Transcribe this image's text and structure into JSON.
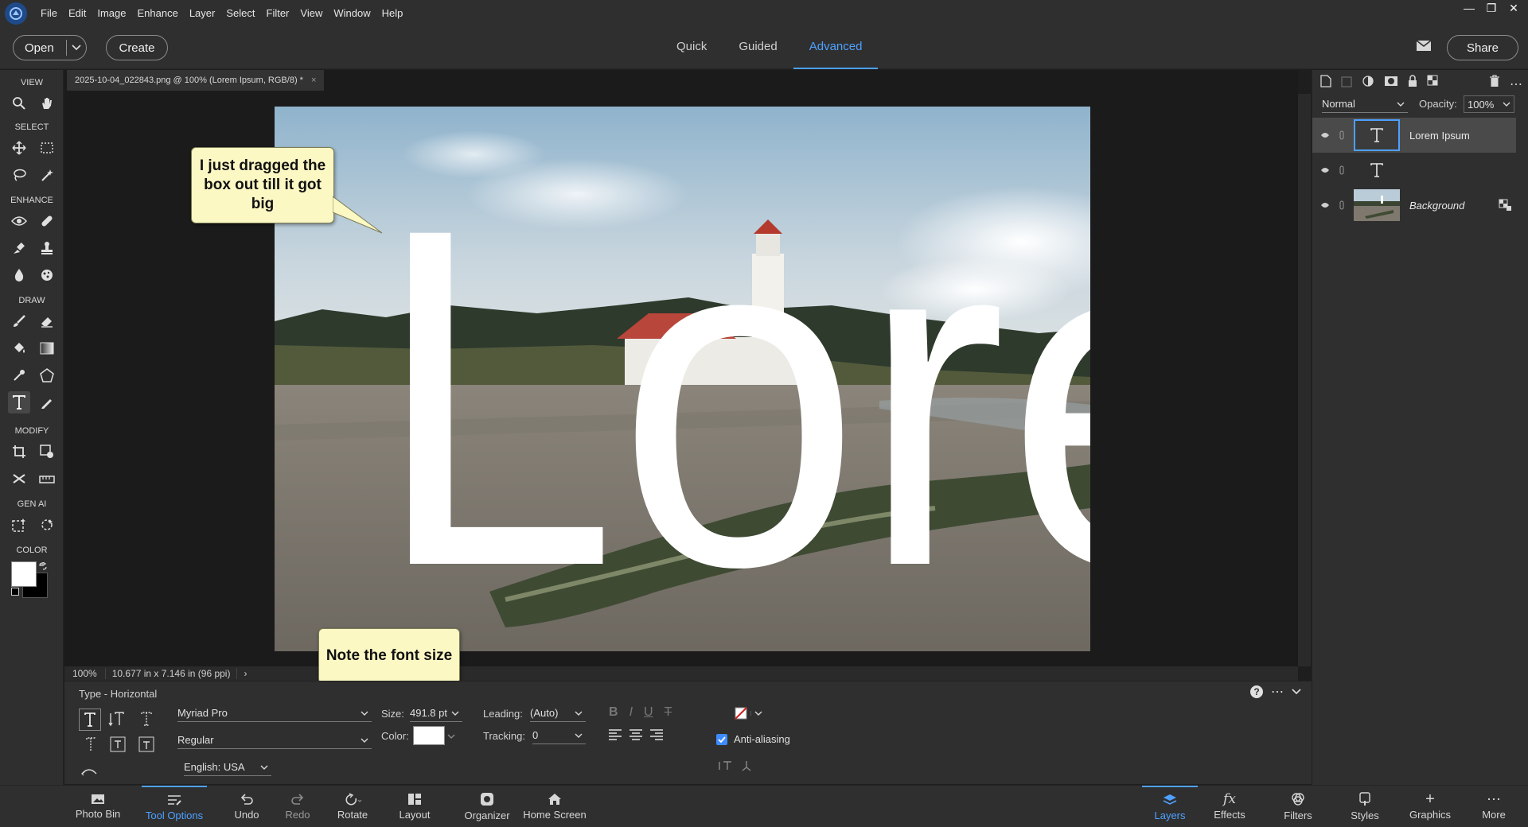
{
  "menu": [
    "File",
    "Edit",
    "Image",
    "Enhance",
    "Layer",
    "Select",
    "Filter",
    "View",
    "Window",
    "Help"
  ],
  "topbar": {
    "open_label": "Open",
    "create_label": "Create",
    "modes": [
      "Quick",
      "Guided",
      "Advanced"
    ],
    "active_mode": "Advanced",
    "share_label": "Share"
  },
  "toolbox": {
    "sections": [
      "VIEW",
      "SELECT",
      "ENHANCE",
      "DRAW",
      "MODIFY",
      "GEN AI",
      "COLOR"
    ]
  },
  "document": {
    "tab_title": "2025-10-04_022843.png @ 100% (Lorem Ipsum, RGB/8) *",
    "canvas_text": "Lore",
    "zoom": "100%",
    "dimensions": "10.677 in x 7.146 in (96 ppi)"
  },
  "callouts": {
    "drag_note": "I just dragged the box out till it got big",
    "font_note": "Note the font size"
  },
  "layers_panel": {
    "blend_mode": "Normal",
    "opacity_label": "Opacity:",
    "opacity_value": "100%",
    "layers": [
      {
        "name": "Lorem Ipsum",
        "type": "text",
        "selected": true
      },
      {
        "name": "",
        "type": "text",
        "selected": false
      },
      {
        "name": "Background",
        "type": "image",
        "selected": false
      }
    ]
  },
  "tool_options": {
    "title": "Type - Horizontal",
    "font_family": "Myriad Pro",
    "font_style": "Regular",
    "language": "English: USA",
    "size_label": "Size:",
    "size_value": "491.8 pt",
    "color_label": "Color:",
    "text_color": "#ffffff",
    "leading_label": "Leading:",
    "leading_value": "(Auto)",
    "tracking_label": "Tracking:",
    "tracking_value": "0",
    "antialias_label": "Anti-aliasing",
    "antialias_checked": true
  },
  "bottombar": {
    "left": [
      "Photo Bin",
      "Tool Options",
      "Undo",
      "Redo",
      "Rotate",
      "Layout",
      "Organizer",
      "Home Screen"
    ],
    "active_left": "Tool Options",
    "right": [
      "Layers",
      "Effects",
      "Filters",
      "Styles",
      "Graphics",
      "More"
    ],
    "active_right": "Layers"
  },
  "colors": {
    "accent": "#4ea1ff",
    "callout_bg": "#fcf8c4",
    "panel_bg": "#2f2f2f",
    "foreground": "#ffffff",
    "background": "#000000"
  }
}
